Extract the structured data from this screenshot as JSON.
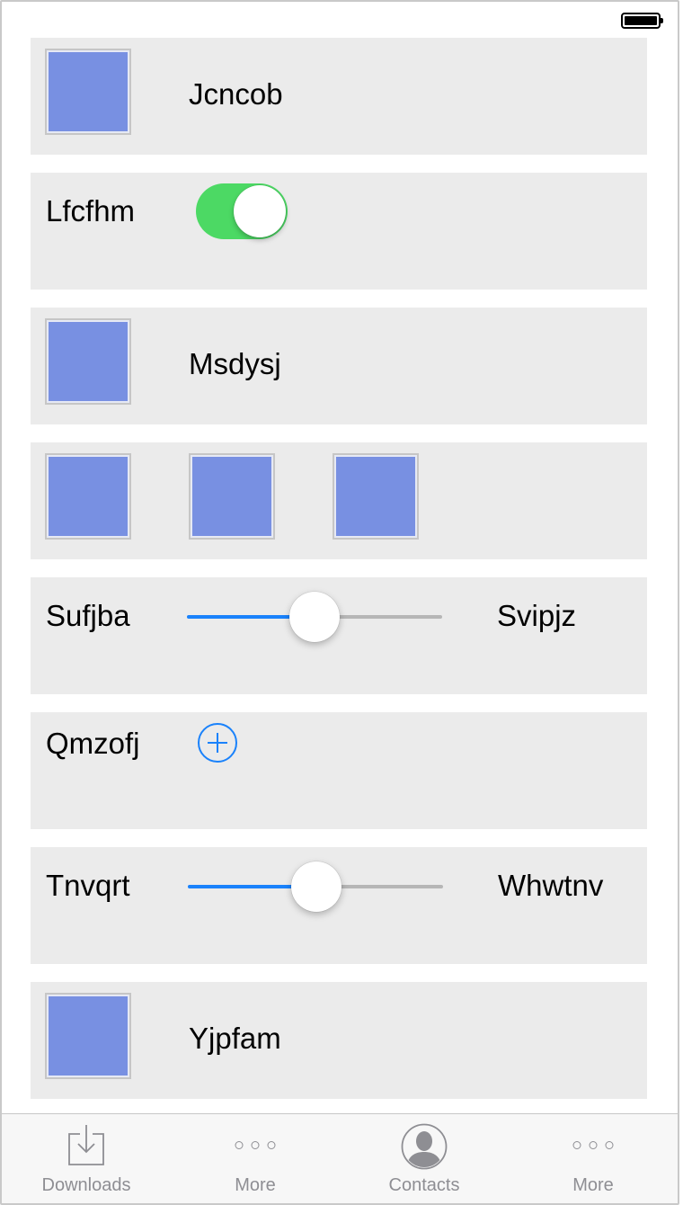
{
  "status_bar": {
    "battery": "full"
  },
  "rows": [
    {
      "type": "image-label",
      "label": "Jcncob"
    },
    {
      "type": "switch",
      "label": "Lfcfhm",
      "on": true
    },
    {
      "type": "image-label",
      "label": "Msdysj"
    },
    {
      "type": "image-grid",
      "count": 3
    },
    {
      "type": "slider",
      "min_label": "Sufjba",
      "max_label": "Svipjz",
      "value": 0.5
    },
    {
      "type": "add",
      "label": "Qmzofj"
    },
    {
      "type": "slider",
      "min_label": "Tnvqrt",
      "max_label": "Whwtnv",
      "value": 0.5
    },
    {
      "type": "image-label",
      "label": "Yjpfam"
    }
  ],
  "tabbar": {
    "tabs": [
      {
        "label": "Downloads",
        "icon": "download-icon"
      },
      {
        "label": "More",
        "icon": "more-icon"
      },
      {
        "label": "Contacts",
        "icon": "contacts-icon"
      },
      {
        "label": "More",
        "icon": "more-icon"
      }
    ]
  },
  "colors": {
    "placeholder": "#7890e2",
    "switch_on": "#4cd964",
    "tint": "#1a82fb",
    "row_bg": "#ebebeb",
    "tab_inactive": "#8e8e93"
  }
}
